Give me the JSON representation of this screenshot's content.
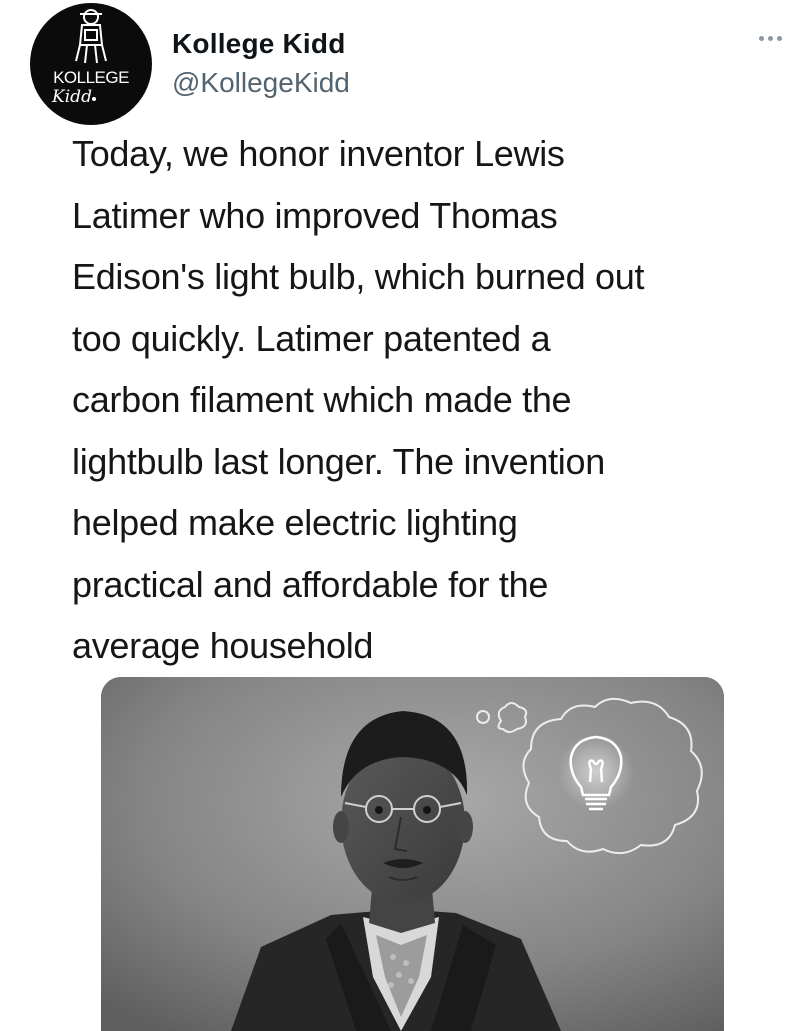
{
  "author": {
    "name": "Kollege Kidd",
    "handle": "@KollegeKidd",
    "avatar_logo": {
      "line1": "KOLLEGE",
      "line2": "Kidd"
    }
  },
  "menu": {
    "icon": "more-horizontal-icon"
  },
  "tweet": {
    "lines": [
      "Today, we honor inventor Lewis",
      "Latimer who improved Thomas",
      "Edison's light bulb, which burned out",
      "too quickly. Latimer patented a",
      "carbon filament which made the",
      "lightbulb last longer. The invention",
      "helped make electric lighting",
      "practical and affordable for the",
      "average household"
    ]
  },
  "media": {
    "icons": [
      "lightbulb-icon",
      "thought-bubble-icon"
    ]
  },
  "colors": {
    "text": "#0f1419",
    "secondary": "#536471",
    "avatar_bg": "#0b0b0b"
  }
}
